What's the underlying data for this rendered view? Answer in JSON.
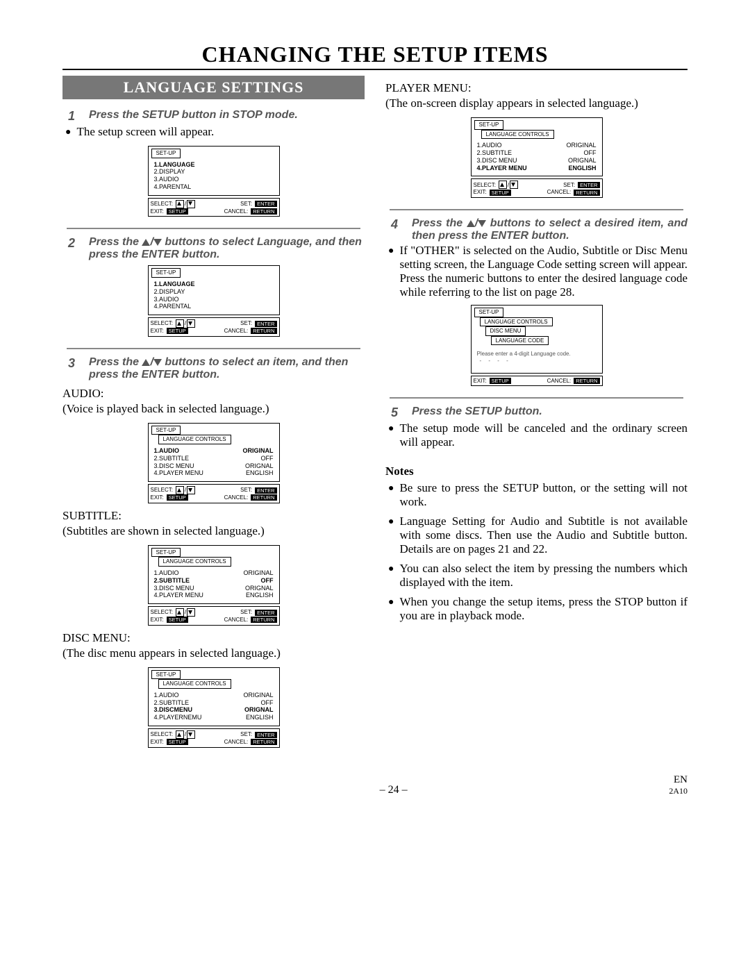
{
  "title": "CHANGING THE SETUP ITEMS",
  "section": "LANGUAGE SETTINGS",
  "steps": {
    "s1": "Press the SETUP button in STOP mode.",
    "s1_bullet": "The setup screen will appear.",
    "s2_a": "Press the ",
    "s2_b": " buttons to select Language, and then press the ENTER button.",
    "s3_a": "Press the ",
    "s3_b": " buttons to select an item, and then press the ENTER button.",
    "s4_a": "Press the ",
    "s4_b": " buttons to select a desired item, and then press the ENTER button.",
    "s4_bullet": "If \"OTHER\" is selected on the Audio, Subtitle or Disc Menu setting screen, the Language Code setting screen will appear. Press the numeric buttons to enter the desired language code while referring to the list on page 28.",
    "s5": "Press the SETUP button.",
    "s5_bullet": "The setup mode will be canceled and the ordinary screen will appear."
  },
  "subs": {
    "audio_h": "AUDIO:",
    "audio_d": "(Voice is played back in selected language.)",
    "subtitle_h": "SUBTITLE:",
    "subtitle_d": "(Subtitles are shown in selected language.)",
    "disc_h": "DISC MENU:",
    "disc_d": "(The disc menu appears in selected language.)",
    "player_h": "PLAYER MENU:",
    "player_d": "(The on-screen display appears in selected language.)"
  },
  "notes_h": "Notes",
  "notes": {
    "n1": "Be sure to press the SETUP button, or the setting will not work.",
    "n2": "Language Setting for Audio and Subtitle is not available with some discs. Then use the Audio and Subtitle button. Details are on pages 21 and 22.",
    "n3": "You can also select the item by pressing the numbers which displayed with the item.",
    "n4": "When you change the setup items, press the STOP button if you are in playback mode."
  },
  "osd": {
    "setup_tab": "SET-UP",
    "lang_tab": "LANGUAGE CONTROLS",
    "disc_tab": "DISC MENU",
    "code_tab": "LANGUAGE CODE",
    "main_items": {
      "i1": "1.LANGUAGE",
      "i2": "2.DISPLAY",
      "i3": "3.AUDIO",
      "i4": "4.PARENTAL"
    },
    "lang_items": {
      "audio": "1.AUDIO",
      "audio_v": "ORIGINAL",
      "sub": "2.SUBTITLE",
      "sub_v": "OFF",
      "disc": "3.DISC MENU",
      "disc_v": "ORIGNAL",
      "disc2": "3.DISCMENU",
      "player": "4.PLAYER MENU",
      "player2": "4.PLAYERNEMU",
      "player_v": "ENGLISH"
    },
    "code_prompt": "Please enter a 4-digit Language code.",
    "dots": "- - - -",
    "select": "SELECT:",
    "set": "SET:",
    "enter": "ENTER",
    "exit": "EXIT:",
    "setup": "SETUP",
    "cancel": "CANCEL:",
    "return": "RETURN"
  },
  "footer": {
    "page": "– 24 –",
    "lang": "EN",
    "code": "2A10"
  }
}
